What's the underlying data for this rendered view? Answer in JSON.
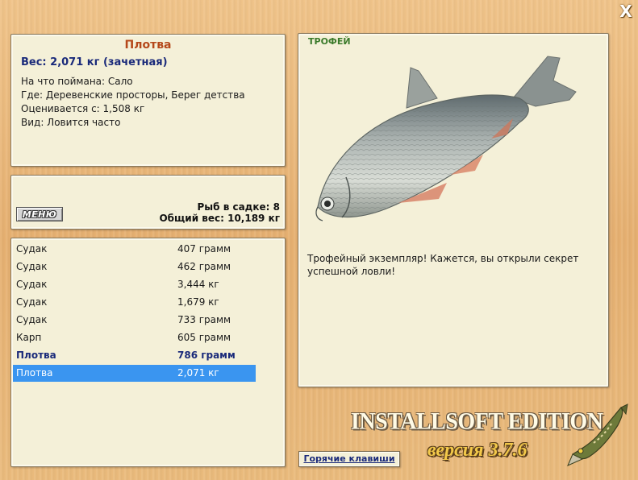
{
  "close_label": "X",
  "fish": {
    "title": "Плотва",
    "weight_line": "Вес: 2,071 кг (зачетная)",
    "bait": "На что поймана: Сало",
    "location": "Где: Деревенские просторы, Берег детства",
    "valued_from": "Оценивается с: 1,508 кг",
    "kind": "Вид: Ловится часто"
  },
  "menu": {
    "button_label": "МЕНЮ",
    "fish_count": "Рыб в садке: 8",
    "total_weight": "Общий вес: 10,189 кг"
  },
  "catch_list": [
    {
      "name": "Судак",
      "weight": "407 грамм",
      "state": "normal"
    },
    {
      "name": "Судак",
      "weight": "462 грамм",
      "state": "normal"
    },
    {
      "name": "Судак",
      "weight": "3,444 кг",
      "state": "normal"
    },
    {
      "name": "Судак",
      "weight": "1,679 кг",
      "state": "normal"
    },
    {
      "name": "Судак",
      "weight": "733 грамм",
      "state": "normal"
    },
    {
      "name": "Карп",
      "weight": "605 грамм",
      "state": "normal"
    },
    {
      "name": "Плотва",
      "weight": "786 грамм",
      "state": "highlighted"
    },
    {
      "name": "Плотва",
      "weight": "2,071 кг",
      "state": "selected"
    }
  ],
  "trophy": {
    "label": "ТРОФЕЙ",
    "text": "Трофейный экземпляр! Кажется, вы открыли секрет успешной ловли!"
  },
  "hotkeys_label": "Горячие клавиши",
  "edition": {
    "title": "INSTALLSOFT EDITION",
    "version": "версия 3.7.6"
  },
  "colors": {
    "selected_row": "#3a95f0",
    "title_accent": "#b5481a",
    "weight_accent": "#1a2a7a",
    "trophy_accent": "#3a7a2a"
  }
}
